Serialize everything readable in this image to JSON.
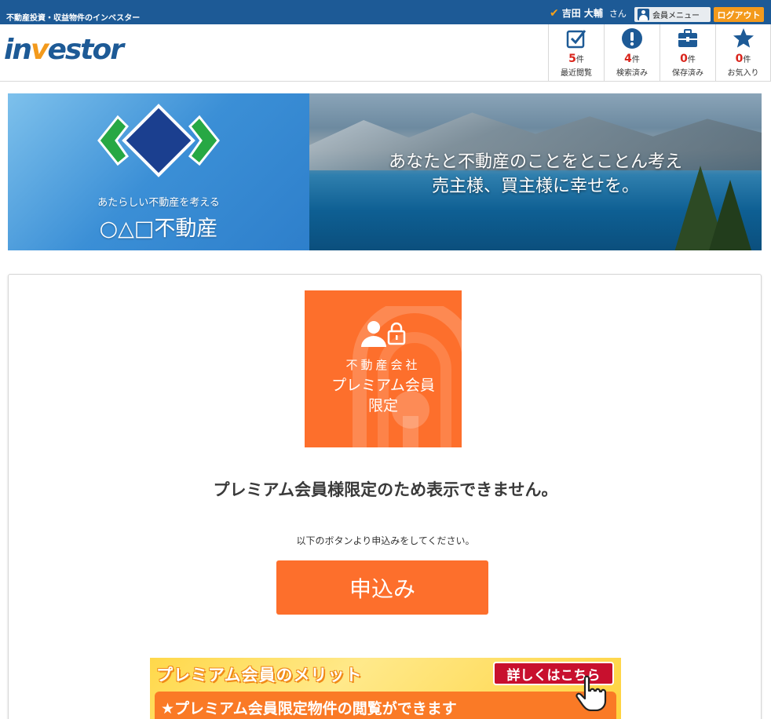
{
  "topbar": {
    "tagline": "不動産投資・収益物件のインベスター",
    "user_name": "吉田 大輔",
    "user_suffix": "さん",
    "member_menu": "会員メニュー",
    "logout": "ログアウト"
  },
  "header": {
    "logo_pre": "in",
    "logo_accent": "v",
    "logo_post": "estor",
    "stats": [
      {
        "icon": "checkbox-icon",
        "count": "5",
        "unit": "件",
        "label": "最近閲覧"
      },
      {
        "icon": "exclamation-icon",
        "count": "4",
        "unit": "件",
        "label": "検索済み"
      },
      {
        "icon": "briefcase-icon",
        "count": "0",
        "unit": "件",
        "label": "保存済み"
      },
      {
        "icon": "star-icon",
        "count": "0",
        "unit": "件",
        "label": "お気入り"
      }
    ]
  },
  "banner": {
    "subtitle": "あたらしい不動産を考える",
    "company": "○△□不動産",
    "copy_line1": "あなたと不動産のことをとことん考え",
    "copy_line2": "売主様、買主様に幸せを。"
  },
  "premium": {
    "line1": "不動産会社",
    "line2": "プレミアム会員",
    "line3": "限定"
  },
  "message": "プレミアム会員様限定のため表示できません。",
  "sub_message": "以下のボタンより申込みをしてください。",
  "apply_button": "申込み",
  "merit": {
    "title": "プレミアム会員のメリット",
    "link": "詳しくはこちら",
    "point": "★プレミアム会員限定物件の閲覧ができます"
  },
  "colors": {
    "topbar": "#1d5a96",
    "accent_orange": "#fd6f2c",
    "logout_orange": "#f39a1c",
    "count_red": "#d9251c"
  }
}
